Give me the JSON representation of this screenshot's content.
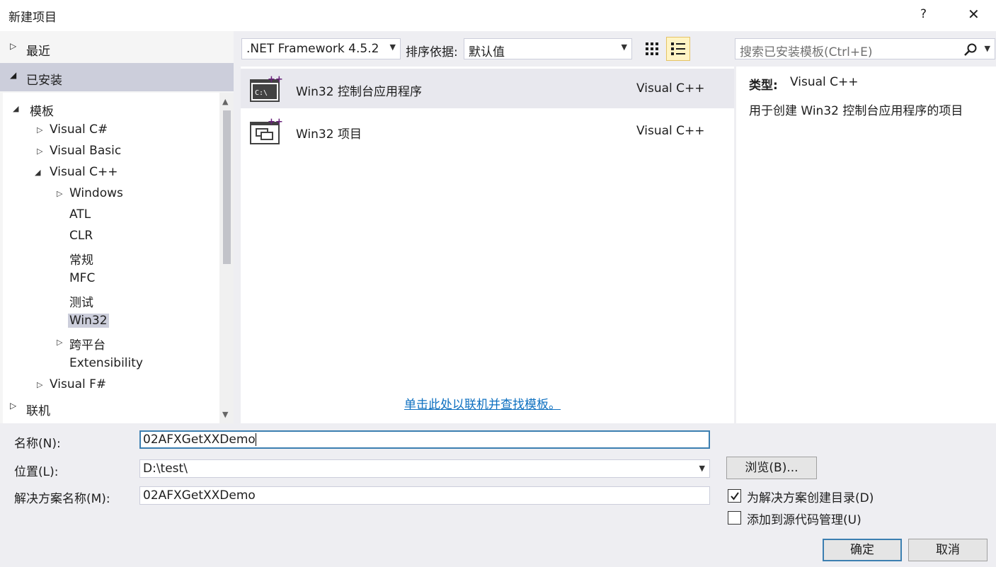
{
  "dialog": {
    "title": "新建项目",
    "help": "?",
    "close": "✕"
  },
  "left_pane": {
    "recent": "最近",
    "installed": "已安装",
    "online": "联机",
    "tree": [
      {
        "label": "模板",
        "arrow": "◢"
      },
      {
        "label": "Visual C#",
        "arrow": "▷"
      },
      {
        "label": "Visual Basic",
        "arrow": "▷"
      },
      {
        "label": "Visual C++",
        "arrow": "◢"
      },
      {
        "label": "Windows",
        "arrow": "▷"
      },
      {
        "label": "ATL"
      },
      {
        "label": "CLR"
      },
      {
        "label": "常规"
      },
      {
        "label": "MFC"
      },
      {
        "label": "测试"
      },
      {
        "label": "Win32"
      },
      {
        "label": "跨平台",
        "arrow": "▷"
      },
      {
        "label": "Extensibility"
      },
      {
        "label": "Visual F#",
        "arrow": "▷"
      }
    ]
  },
  "toolbar": {
    "framework": ".NET Framework 4.5.2",
    "sort_label": "排序依据:",
    "sort_value": "默认值",
    "search_placeholder": "搜索已安装模板(Ctrl+E)"
  },
  "templates": [
    {
      "name": "Win32 控制台应用程序",
      "lang": "Visual C++",
      "icon": "console-app-icon"
    },
    {
      "name": "Win32 项目",
      "lang": "Visual C++",
      "icon": "win32-project-icon"
    }
  ],
  "online_link": "单击此处以联机并查找模板。",
  "details": {
    "type_label": "类型:",
    "type_value": "Visual C++",
    "description": "用于创建 Win32 控制台应用程序的项目"
  },
  "form": {
    "name_label": "名称(N):",
    "name_value": "02AFXGetXXDemo",
    "location_label": "位置(L):",
    "location_value": "D:\\test\\",
    "solution_label": "解决方案名称(M):",
    "solution_value": "02AFXGetXXDemo",
    "browse": "浏览(B)...",
    "create_dir": "为解决方案创建目录(D)",
    "create_dir_checked": true,
    "add_scc": "添加到源代码管理(U)",
    "add_scc_checked": false,
    "ok": "确定",
    "cancel": "取消"
  },
  "colors": {
    "accent": "#3c7fb1",
    "link": "#0e70c0",
    "selection": "#cccedb"
  }
}
